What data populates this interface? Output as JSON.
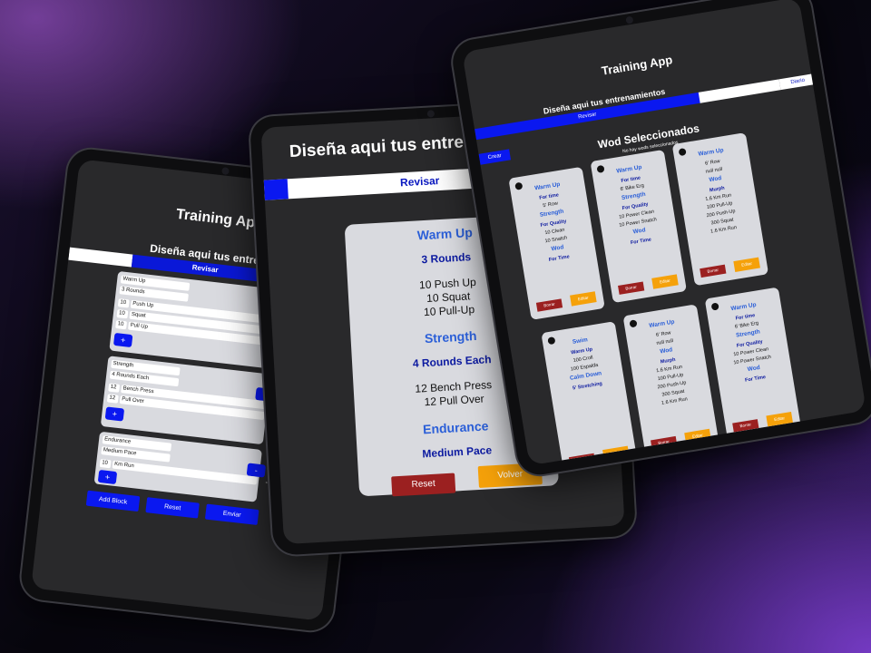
{
  "builder": {
    "title": "Training App",
    "subtitle": "Diseña aqui tus entrenamientos",
    "tab_review": "Revisar",
    "blocks": [
      {
        "name": "Warm Up",
        "rounds": "3 Rounds",
        "exercises": [
          {
            "qty": "10",
            "name": "Push Up"
          },
          {
            "qty": "10",
            "name": "Squat"
          },
          {
            "qty": "10",
            "name": "Pull Up"
          }
        ]
      },
      {
        "name": "Strength",
        "rounds": "4 Rounds Each",
        "exercises": [
          {
            "qty": "12",
            "name": "Bench Press"
          },
          {
            "qty": "12",
            "name": "Pull Over"
          }
        ]
      },
      {
        "name": "Endurance",
        "rounds": "Medium Pace",
        "exercises": [
          {
            "qty": "10",
            "name": "Km Run"
          }
        ]
      }
    ],
    "plus_label": "+",
    "minus_label": "-",
    "dash": "-",
    "add_block": "Add Block",
    "reset": "Reset",
    "send": "Enviar"
  },
  "review": {
    "heading": "Diseña aqui tus entrenamientos",
    "tab_review": "Revisar",
    "sections": [
      {
        "name": "Warm Up",
        "rounds": "3 Rounds",
        "exercises": [
          "10  Push Up",
          "10  Squat",
          "10  Pull-Up"
        ]
      },
      {
        "name": "Strength",
        "rounds": "4 Rounds Each",
        "exercises": [
          "12  Bench Press",
          "12  Pull Over"
        ]
      },
      {
        "name": "Endurance",
        "rounds": "Medium Pace",
        "exercises": []
      }
    ],
    "reset": "Reset",
    "back": "Volver"
  },
  "wods": {
    "title": "Training App",
    "subtitle": "Diseña aqui tus entrenamientos",
    "tab_review": "Revisar",
    "tab_daily": "Diario",
    "tab_create": "Crear",
    "heading": "Wod Seleccionados",
    "empty_note": "No hay wods seleccionados",
    "delete": "Borrar",
    "edit": "Editar",
    "cards": [
      {
        "lines": [
          [
            "s",
            "Warm Up"
          ],
          [
            "r",
            "For time"
          ],
          [
            "e",
            "5' Row"
          ],
          [
            "s",
            "Strength"
          ],
          [
            "r",
            "For Quality"
          ],
          [
            "e",
            "10 Clean"
          ],
          [
            "e",
            "10 Snatch"
          ],
          [
            "s",
            "Wod"
          ],
          [
            "r",
            "For Time"
          ]
        ]
      },
      {
        "lines": [
          [
            "s",
            "Warm Up"
          ],
          [
            "r",
            "For time"
          ],
          [
            "e",
            "6' Bike Erg"
          ],
          [
            "s",
            "Strength"
          ],
          [
            "r",
            "For Quality"
          ],
          [
            "e",
            "10 Power Clean"
          ],
          [
            "e",
            "10 Power Snatch"
          ],
          [
            "s",
            "Wod"
          ],
          [
            "r",
            "For Time"
          ]
        ]
      },
      {
        "lines": [
          [
            "s",
            "Warm Up"
          ],
          [
            "e",
            "6' Row"
          ],
          [
            "e",
            "null null"
          ],
          [
            "s",
            "Wod"
          ],
          [
            "r",
            "Murph"
          ],
          [
            "e",
            "1.6 Km Run"
          ],
          [
            "e",
            "100 Pull-Up"
          ],
          [
            "e",
            "200 Push-Up"
          ],
          [
            "e",
            "300 Squat"
          ],
          [
            "e",
            "1.6 Km Run"
          ]
        ]
      },
      {
        "lines": [
          [
            "s",
            "Swim"
          ],
          [
            "r",
            "Warm Up"
          ],
          [
            "e",
            "100 Croll"
          ],
          [
            "e",
            "100 Espalda"
          ],
          [
            "s",
            "Calm Down"
          ],
          [
            "r",
            "5' Stretching"
          ]
        ]
      }
    ]
  }
}
